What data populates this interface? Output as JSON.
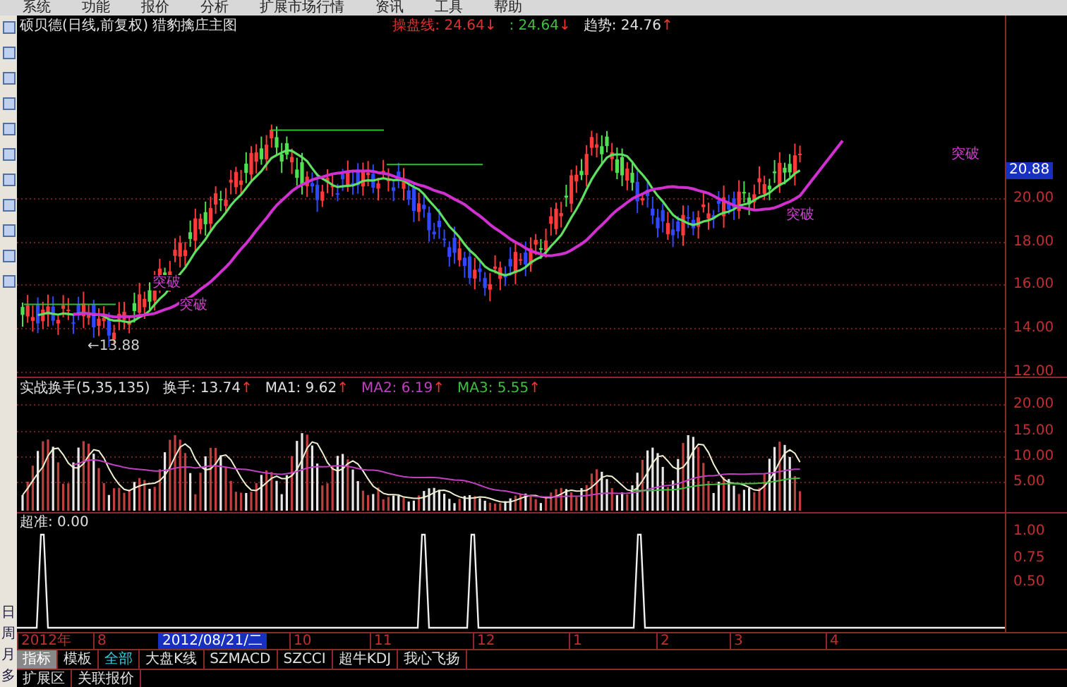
{
  "menu_bar": [
    "系统",
    "功能",
    "报价",
    "分析",
    "扩展市场行情",
    "资讯",
    "工具",
    "帮助"
  ],
  "side_toolbar": {
    "labels": [
      "日",
      "周",
      "月",
      "多"
    ]
  },
  "main_panel": {
    "title": "硕贝德(日线,前复权) 猎豹擒庄主图",
    "indicators": [
      {
        "label": "操盘线: 24.64",
        "arrow": "↓",
        "color": "#e03030"
      },
      {
        "label": ": 24.64",
        "arrow": "↓",
        "color": "#40c040"
      },
      {
        "label": "趋势: 24.76",
        "arrow": "↑",
        "color": "#e0e0e0"
      }
    ],
    "annotations": [
      "突破",
      "突破",
      "突破",
      "突破"
    ],
    "low_label": "←13.88",
    "current_price": "20.88",
    "axis": [
      "20.00",
      "18.00",
      "16.00",
      "14.00",
      "12.00"
    ]
  },
  "turnover_panel": {
    "title": "实战换手(5,35,135)",
    "indicators": [
      {
        "label": "换手: 13.74",
        "arrow": "↑",
        "color": "#e0e0e0"
      },
      {
        "label": "MA1: 9.62",
        "arrow": "↑",
        "color": "#e0e0e0"
      },
      {
        "label": "MA2: 6.19",
        "arrow": "↑",
        "color": "#c040c0"
      },
      {
        "label": "MA3: 5.55",
        "arrow": "↑",
        "color": "#40c040"
      }
    ],
    "axis": [
      "20.00",
      "15.00",
      "10.00",
      "5.00"
    ]
  },
  "signal_panel": {
    "title": "超准: 0.00",
    "axis": [
      "1.00",
      "0.75",
      "0.50"
    ]
  },
  "date_axis": {
    "labels": [
      "2012年",
      "8",
      "10",
      "11",
      "12",
      "1",
      "2",
      "3",
      "4"
    ],
    "cursor_date": "2012/08/21/二"
  },
  "tabs": [
    {
      "label": "指标",
      "selected": false
    },
    {
      "label": "模板",
      "selected": false
    },
    {
      "label": "全部",
      "selected": true
    },
    {
      "label": "大盘K线",
      "selected": false
    },
    {
      "label": "SZMACD",
      "selected": false
    },
    {
      "label": "SZCCI",
      "selected": false
    },
    {
      "label": "超牛KDJ",
      "selected": false
    },
    {
      "label": "我心飞扬",
      "selected": false
    }
  ],
  "bottom_tabs": [
    "扩展区",
    "关联报价"
  ]
}
